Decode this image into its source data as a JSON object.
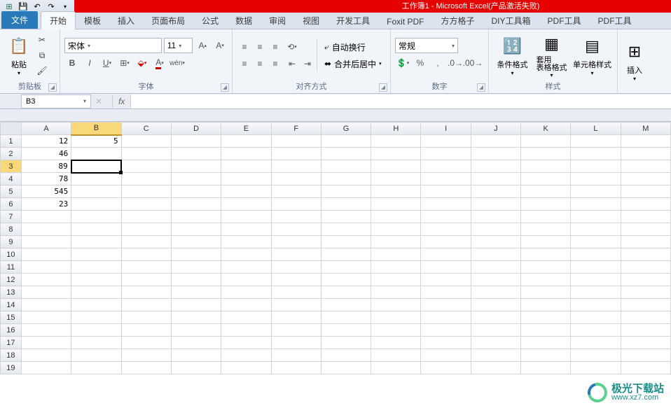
{
  "titlebar": {
    "title": "工作簿1 - Microsoft Excel(产品激活失败)"
  },
  "tabs": {
    "file": "文件",
    "items": [
      "开始",
      "模板",
      "插入",
      "页面布局",
      "公式",
      "数据",
      "审阅",
      "视图",
      "开发工具",
      "Foxit PDF",
      "方方格子",
      "DIY工具箱",
      "PDF工具",
      "PDF工具"
    ],
    "active_index": 0
  },
  "ribbon": {
    "clipboard": {
      "paste": "粘贴",
      "label": "剪贴板"
    },
    "font": {
      "name": "宋体",
      "size": "11",
      "label": "字体"
    },
    "alignment": {
      "wrap": "自动换行",
      "merge": "合并后居中",
      "label": "对齐方式"
    },
    "number": {
      "format": "常规",
      "label": "数字"
    },
    "styles": {
      "cond": "条件格式",
      "table": "套用\n表格格式",
      "cell": "单元格样式",
      "label": "样式"
    },
    "cells": {
      "insert": "插入"
    }
  },
  "formula_bar": {
    "name": "B3",
    "fx": "fx",
    "value": ""
  },
  "grid": {
    "columns": [
      "A",
      "B",
      "C",
      "D",
      "E",
      "F",
      "G",
      "H",
      "I",
      "J",
      "K",
      "L",
      "M"
    ],
    "rows": 19,
    "active": {
      "row": 3,
      "col": "B"
    },
    "data": {
      "A1": "12",
      "B1": "5",
      "A2": "46",
      "A3": "89",
      "A4": "78",
      "A5": "545",
      "A6": "23"
    }
  },
  "watermark": {
    "line1": "极光下载站",
    "line2": "www.xz7.com"
  }
}
